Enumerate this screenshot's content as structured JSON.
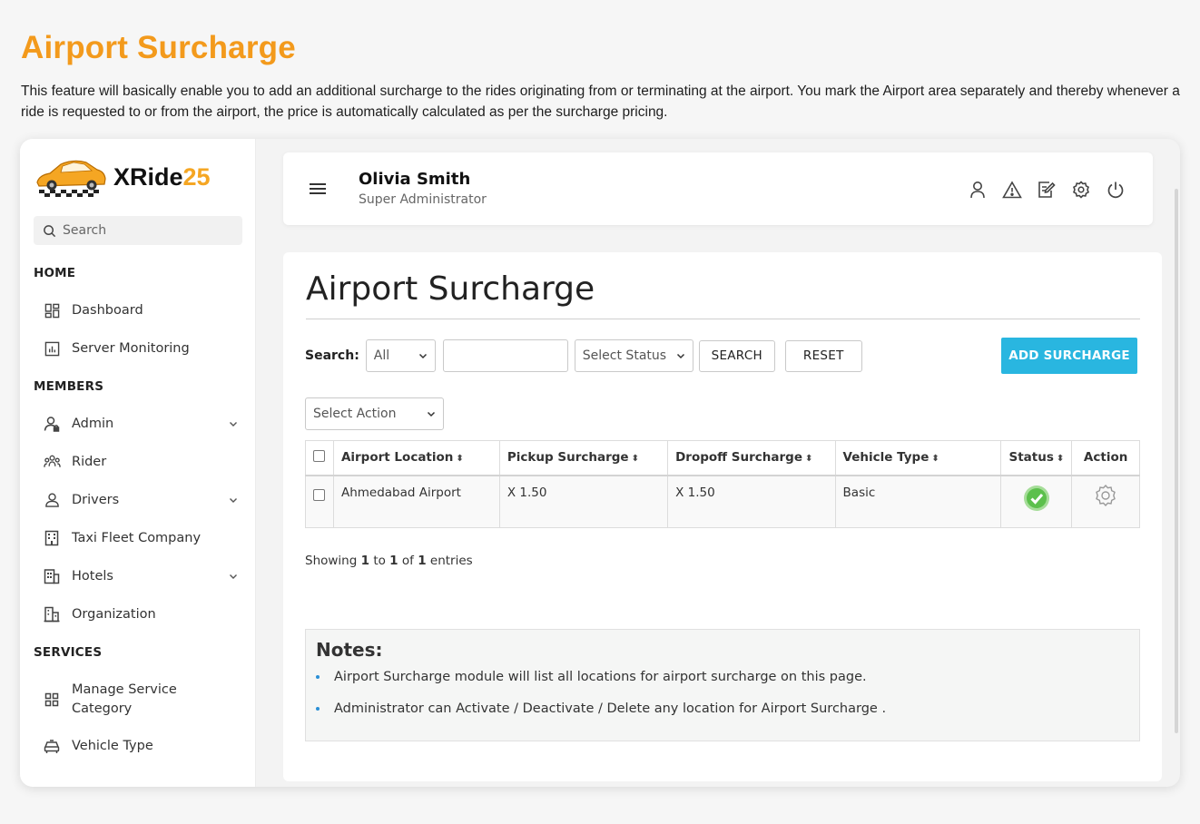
{
  "promo": {
    "title": "Airport Surcharge",
    "description": "This feature will basically enable you to add an additional surcharge to the rides originating from or terminating at the airport. You mark the Airport area separately and thereby whenever a ride is requested to or from the airport, the price is automatically calculated as per the surcharge pricing."
  },
  "brand": {
    "name": "XRide",
    "number": "25",
    "accent": "#f5a623"
  },
  "sidebar": {
    "search_placeholder": "Search",
    "sections": {
      "home": "HOME",
      "members": "MEMBERS",
      "services": "SERVICES"
    },
    "items": [
      {
        "label": "Dashboard",
        "icon": "dashboard-icon"
      },
      {
        "label": "Server Monitoring",
        "icon": "chart-icon"
      },
      {
        "label": "Admin",
        "icon": "admin-user-icon",
        "expandable": true
      },
      {
        "label": "Rider",
        "icon": "group-icon"
      },
      {
        "label": "Drivers",
        "icon": "driver-icon",
        "expandable": true
      },
      {
        "label": "Taxi Fleet Company",
        "icon": "building-icon"
      },
      {
        "label": "Hotels",
        "icon": "hotel-icon",
        "expandable": true
      },
      {
        "label": "Organization",
        "icon": "organization-icon"
      },
      {
        "label": "Manage Service Category",
        "icon": "grid-icon"
      },
      {
        "label": "Vehicle Type",
        "icon": "car-icon"
      }
    ]
  },
  "header": {
    "user_name": "Olivia Smith",
    "user_role": "Super Administrator",
    "icons": [
      "user-icon",
      "alert-icon",
      "edit-icon",
      "settings-icon",
      "power-icon"
    ]
  },
  "main": {
    "title": "Airport Surcharge",
    "search_label": "Search:",
    "filter_select": "All",
    "search_value": "",
    "status_select": "Select Status",
    "search_button": "SEARCH",
    "reset_button": "RESET",
    "add_button": "ADD SURCHARGE",
    "action_select": "Select Action",
    "columns": [
      "Airport Location",
      "Pickup Surcharge",
      "Dropoff Surcharge",
      "Vehicle Type",
      "Status",
      "Action"
    ],
    "rows": [
      {
        "airport_location": "Ahmedabad Airport",
        "pickup_surcharge": "X 1.50",
        "dropoff_surcharge": "X 1.50",
        "vehicle_type": "Basic",
        "status": "active"
      }
    ],
    "showing": {
      "prefix": "Showing",
      "from": "1",
      "to_word": "to",
      "to": "1",
      "of_word": "of",
      "total": "1",
      "suffix": "entries"
    },
    "notes": {
      "title": "Notes:",
      "items": [
        "Airport Surcharge module will list all locations for airport surcharge on this page.",
        "Administrator can Activate / Deactivate / Delete any location for Airport Surcharge ."
      ]
    }
  },
  "colors": {
    "promo_title": "#f39a1c",
    "add_button": "#29b6e0",
    "status_active": "#5cc04c"
  }
}
